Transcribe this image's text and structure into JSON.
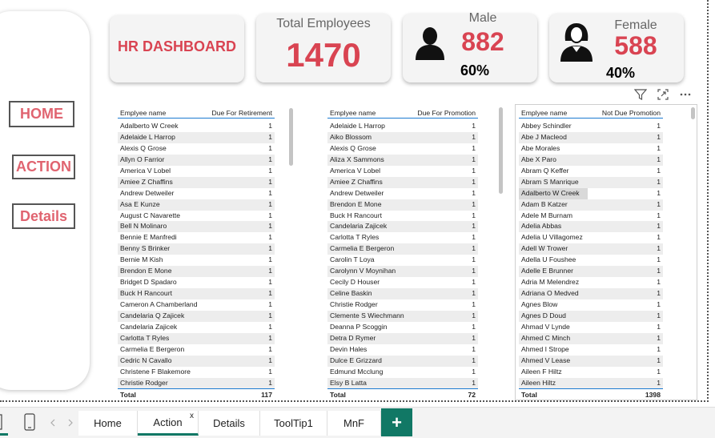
{
  "nav": {
    "home": "HOME",
    "action": "ACTION",
    "details": "Details"
  },
  "cards": {
    "title": "HR DASHBOARD",
    "total_label": "Total Employees",
    "total_value": "1470",
    "male_label": "Male",
    "male_value": "882",
    "male_pct": "60%",
    "female_label": "Female",
    "female_value": "588",
    "female_pct": "40%"
  },
  "tables": {
    "retirement": {
      "col1": "Emplyee name",
      "col2": "Due For Retirement",
      "rows": [
        [
          "Adalberto W Creek",
          "1"
        ],
        [
          "Adelaide L Harrop",
          "1"
        ],
        [
          "Alexis Q Grose",
          "1"
        ],
        [
          "Allyn O Farrior",
          "1"
        ],
        [
          "America V Lobel",
          "1"
        ],
        [
          "Amiee Z Chaffins",
          "1"
        ],
        [
          "Andrew Detweiler",
          "1"
        ],
        [
          "Asa E Kunze",
          "1"
        ],
        [
          "August C Navarette",
          "1"
        ],
        [
          "Bell N Molinaro",
          "1"
        ],
        [
          "Bennie E Manfredi",
          "1"
        ],
        [
          "Benny S Brinker",
          "1"
        ],
        [
          "Bernie M Kish",
          "1"
        ],
        [
          "Brendon E Mone",
          "1"
        ],
        [
          "Bridget D Spadaro",
          "1"
        ],
        [
          "Buck H Rancourt",
          "1"
        ],
        [
          "Cameron A Chamberland",
          "1"
        ],
        [
          "Candelaria Q Zajicek",
          "1"
        ],
        [
          "Candelaria Zajicek",
          "1"
        ],
        [
          "Carlotta T Ryles",
          "1"
        ],
        [
          "Carmelia E Bergeron",
          "1"
        ],
        [
          "Cedric N Cavallo",
          "1"
        ],
        [
          "Christene F Blakemore",
          "1"
        ],
        [
          "Christie Rodger",
          "1"
        ]
      ],
      "total_label": "Total",
      "total_value": "117"
    },
    "promotion": {
      "col1": "Emplyee name",
      "col2": "Due For Promotion",
      "rows": [
        [
          "Adelaide L Harrop",
          "1"
        ],
        [
          "Aiko Blossom",
          "1"
        ],
        [
          "Alexis Q Grose",
          "1"
        ],
        [
          "Aliza X Sammons",
          "1"
        ],
        [
          "America V Lobel",
          "1"
        ],
        [
          "Amiee Z Chaffins",
          "1"
        ],
        [
          "Andrew Detweiler",
          "1"
        ],
        [
          "Brendon E Mone",
          "1"
        ],
        [
          "Buck H Rancourt",
          "1"
        ],
        [
          "Candelaria Zajicek",
          "1"
        ],
        [
          "Carlotta T Ryles",
          "1"
        ],
        [
          "Carmelia E Bergeron",
          "1"
        ],
        [
          "Carolin T Loya",
          "1"
        ],
        [
          "Carolynn V Moynihan",
          "1"
        ],
        [
          "Cecily D Houser",
          "1"
        ],
        [
          "Celine Baskin",
          "1"
        ],
        [
          "Christie Rodger",
          "1"
        ],
        [
          "Clemente S Wiechmann",
          "1"
        ],
        [
          "Deanna P Scoggin",
          "1"
        ],
        [
          "Detra D Rymer",
          "1"
        ],
        [
          "Devin Hales",
          "1"
        ],
        [
          "Dulce E Grizzard",
          "1"
        ],
        [
          "Edmund Mcclung",
          "1"
        ],
        [
          "Elsy B Latta",
          "1"
        ]
      ],
      "total_label": "Total",
      "total_value": "72"
    },
    "not_due": {
      "col1": "Emplyee name",
      "col2": "Not Due Promotion",
      "rows": [
        [
          "Abbey Schindler",
          "1"
        ],
        [
          "Abe J Macleod",
          "1"
        ],
        [
          "Abe Morales",
          "1"
        ],
        [
          "Abe X Paro",
          "1"
        ],
        [
          "Abram Q Keffer",
          "1"
        ],
        [
          "Abram S Manrique",
          "1"
        ],
        [
          "Adalberto W Creek",
          "1"
        ],
        [
          "Adam B Katzer",
          "1"
        ],
        [
          "Adele M Burnam",
          "1"
        ],
        [
          "Adelia Abbas",
          "1"
        ],
        [
          "Adelia U Villagomez",
          "1"
        ],
        [
          "Adell W Trower",
          "1"
        ],
        [
          "Adella U Foushee",
          "1"
        ],
        [
          "Adelle E Brunner",
          "1"
        ],
        [
          "Adria M Melendrez",
          "1"
        ],
        [
          "Adriana O Medved",
          "1"
        ],
        [
          "Agnes Blow",
          "1"
        ],
        [
          "Agnes D Doud",
          "1"
        ],
        [
          "Ahmad V Lynde",
          "1"
        ],
        [
          "Ahmed C Minch",
          "1"
        ],
        [
          "Ahmed I Strope",
          "1"
        ],
        [
          "Ahmed V Lease",
          "1"
        ],
        [
          "Aileen F Hiltz",
          "1"
        ],
        [
          "Aileen Hiltz",
          "1"
        ]
      ],
      "total_label": "Total",
      "total_value": "1398"
    }
  },
  "tabs": [
    "Home",
    "Action",
    "Details",
    "ToolTip1",
    "MnF"
  ],
  "active_tab": "Action",
  "tab_close": "x",
  "add_tab": "+",
  "icons": [
    "filter-icon",
    "focus-mode-icon",
    "more-options-icon",
    "desktop-layout-icon",
    "mobile-layout-icon",
    "prev-page-icon",
    "next-page-icon"
  ],
  "colors": {
    "accent_red": "#d94452",
    "nav_text": "#e06470",
    "tab_accent": "#117865",
    "table_rule": "#1c7bd1"
  }
}
